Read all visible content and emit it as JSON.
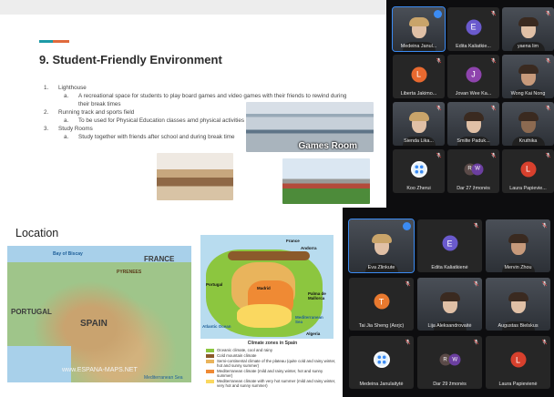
{
  "slide_top": {
    "title": "9. Student-Friendly Environment",
    "items": [
      {
        "num": "1.",
        "label": "Lighthouse",
        "sub": {
          "letter": "a.",
          "text": "A recreational space for students to play board games and video games with their friends to rewind during their break times"
        }
      },
      {
        "num": "2.",
        "label": "Running track and sports field",
        "sub": {
          "letter": "a.",
          "text": "To be used for Physical Education classes amd physical activities"
        }
      },
      {
        "num": "3.",
        "label": "Study Rooms",
        "sub": {
          "letter": "a.",
          "text": "Study together with friends after school and during break time"
        }
      }
    ],
    "photo_caption": "Games Room",
    "accent_colors": [
      "#1d9aa6",
      "#e06a3c"
    ]
  },
  "slide_bottom": {
    "title": "Location",
    "map1_labels": {
      "france": "FRANCE",
      "spain": "SPAIN",
      "portugal": "PORTUGAL",
      "bay": "Bay of Biscay",
      "pyrenees": "PYRENEES",
      "watermark": "www.ESPANA-MAPS.NET",
      "med": "Mediterranean Sea"
    },
    "map2_labels": {
      "france": "France",
      "andorra": "Andorra",
      "portugal": "Portugal",
      "madrid": "Madrid",
      "palma": "Palma de Mallorca",
      "ocean": "Atlantic Ocean",
      "algeria": "Algeria",
      "med": "Mediterranean Sea"
    },
    "legend": {
      "title": "Climate zones in Spain",
      "rows": [
        {
          "color": "#8cc63f",
          "text": "Oceanic climate, cool and rainy"
        },
        {
          "color": "#8b5a2b",
          "text": "Cold mountain climate"
        },
        {
          "color": "#e9b45c",
          "text": "Semi-continental climate of the plateau (quite cold and rainy winter, hot and sunny summer)"
        },
        {
          "color": "#ef8a34",
          "text": "Mediterranean climate (mild and rainy winter, hot and sunny summer)"
        },
        {
          "color": "#fad860",
          "text": "Mediterranean climate with very hot summer (mild and rainy winter, very hot and sunny summer)"
        }
      ]
    }
  },
  "participants_top": [
    {
      "name": "Medeina Janul...",
      "type": "video",
      "active": true,
      "face": "pale blond"
    },
    {
      "name": "Edita Kaliatkie...",
      "type": "avatar",
      "initial": "E",
      "color": "#6a5acd"
    },
    {
      "name": "yaena lim",
      "type": "video",
      "face": "pale"
    },
    {
      "name": "Liberta Jakimo...",
      "type": "avatar",
      "initial": "L",
      "color": "#e8692f"
    },
    {
      "name": "Jovan Wee Ka...",
      "type": "avatar",
      "initial": "J",
      "color": "#8e44ad"
    },
    {
      "name": "Wong Kai Nong",
      "type": "video",
      "face": ""
    },
    {
      "name": "Sienda Lika...",
      "type": "video",
      "face": "pale blond"
    },
    {
      "name": "Smilte Paduk...",
      "type": "video",
      "face": "pale"
    },
    {
      "name": "Kruthika",
      "type": "video",
      "face": "dark"
    },
    {
      "name": "Koo Zherui",
      "type": "icon"
    },
    {
      "name": "Dar 27 žmonės",
      "type": "multi",
      "initials": [
        "R",
        "W"
      ]
    },
    {
      "name": "Laura Papievie...",
      "type": "avatar",
      "initial": "L",
      "color": "#d7402d"
    }
  ],
  "participants_bottom": [
    {
      "name": "Eva Zlinkute",
      "type": "video",
      "active": true,
      "face": "pale blond"
    },
    {
      "name": "Edita Kaliatkienė",
      "type": "avatar",
      "initial": "E",
      "color": "#6a5acd"
    },
    {
      "name": "Mervin Zhou",
      "type": "video",
      "face": ""
    },
    {
      "name": "Tai Jia Sheng (Asrjc)",
      "type": "avatar",
      "initial": "T",
      "color": "#e8792f"
    },
    {
      "name": "Lija Aleksandrovaitė",
      "type": "video",
      "face": "pale"
    },
    {
      "name": "Augustas Bielskus",
      "type": "video",
      "face": "pale"
    },
    {
      "name": "Medeina Janulaitytė",
      "type": "icon"
    },
    {
      "name": "Dar 29 žmonės",
      "type": "multi",
      "initials": [
        "R",
        "W"
      ]
    },
    {
      "name": "Laura Papievienė",
      "type": "avatar",
      "initial": "L",
      "color": "#d7402d"
    }
  ]
}
